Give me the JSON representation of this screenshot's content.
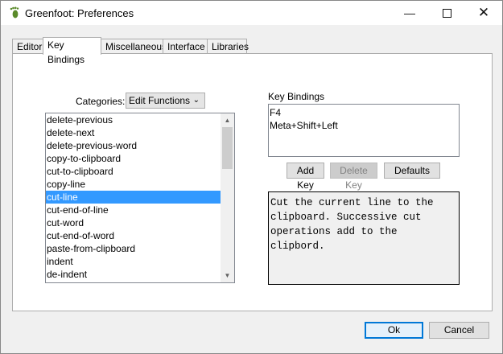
{
  "window": {
    "title": "Greenfoot: Preferences"
  },
  "tabs": [
    {
      "label": "Editor"
    },
    {
      "label": "Key Bindings"
    },
    {
      "label": "Miscellaneous"
    },
    {
      "label": "Interface"
    },
    {
      "label": "Libraries"
    }
  ],
  "active_tab": "Key Bindings",
  "categories": {
    "label": "Categories:",
    "selected": "Edit Functions"
  },
  "functions": [
    "delete-previous",
    "delete-next",
    "delete-previous-word",
    "copy-to-clipboard",
    "cut-to-clipboard",
    "copy-line",
    "cut-line",
    "cut-end-of-line",
    "cut-word",
    "cut-end-of-word",
    "paste-from-clipboard",
    "indent",
    "de-indent"
  ],
  "selected_function": "cut-line",
  "key_bindings": {
    "label": "Key Bindings",
    "items": [
      "F4",
      "Meta+Shift+Left"
    ]
  },
  "buttons": {
    "add_key": "Add Key",
    "delete_key": "Delete Key",
    "defaults": "Defaults"
  },
  "description": "Cut the current line to the clipboard. Successive cut operations add to the clipbord.",
  "footer": {
    "ok": "Ok",
    "cancel": "Cancel"
  }
}
